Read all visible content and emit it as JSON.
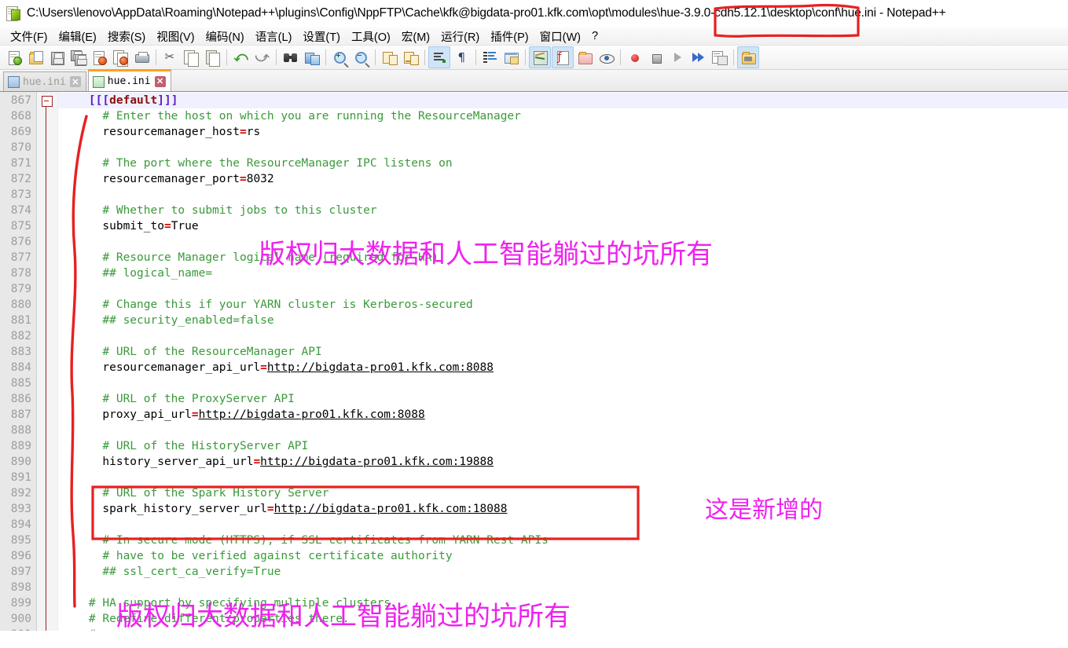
{
  "window": {
    "title": "C:\\Users\\lenovo\\AppData\\Roaming\\Notepad++\\plugins\\Config\\NppFTP\\Cache\\kfk@bigdata-pro01.kfk.com\\opt\\modules\\hue-3.9.0-cdh5.12.1\\desktop\\conf\\hue.ini - Notepad++",
    "icon": "notepad-plus-plus-icon"
  },
  "menubar": {
    "items": [
      {
        "label": "文件(F)",
        "mnemonic": "F"
      },
      {
        "label": "编辑(E)",
        "mnemonic": "E"
      },
      {
        "label": "搜索(S)",
        "mnemonic": "S"
      },
      {
        "label": "视图(V)",
        "mnemonic": "V"
      },
      {
        "label": "编码(N)",
        "mnemonic": "N"
      },
      {
        "label": "语言(L)",
        "mnemonic": "L"
      },
      {
        "label": "设置(T)",
        "mnemonic": "T"
      },
      {
        "label": "工具(O)",
        "mnemonic": "O"
      },
      {
        "label": "宏(M)",
        "mnemonic": "M"
      },
      {
        "label": "运行(R)",
        "mnemonic": "R"
      },
      {
        "label": "插件(P)",
        "mnemonic": "P"
      },
      {
        "label": "窗口(W)",
        "mnemonic": "W"
      },
      {
        "label": "?",
        "mnemonic": ""
      }
    ]
  },
  "toolbar": {
    "buttons": [
      {
        "name": "new-file-icon",
        "group": 0
      },
      {
        "name": "open-file-icon",
        "group": 0
      },
      {
        "name": "save-icon",
        "group": 0
      },
      {
        "name": "save-all-icon",
        "group": 0
      },
      {
        "name": "close-file-icon",
        "group": 0
      },
      {
        "name": "close-all-files-icon",
        "group": 0
      },
      {
        "name": "print-icon",
        "group": 0
      },
      {
        "name": "cut-icon",
        "group": 1
      },
      {
        "name": "copy-icon",
        "group": 1
      },
      {
        "name": "paste-icon",
        "group": 1
      },
      {
        "name": "undo-icon",
        "group": 2
      },
      {
        "name": "redo-icon",
        "group": 2
      },
      {
        "name": "find-icon",
        "group": 3
      },
      {
        "name": "replace-icon",
        "group": 3
      },
      {
        "name": "zoom-in-icon",
        "group": 4
      },
      {
        "name": "zoom-out-icon",
        "group": 4
      },
      {
        "name": "sync-vertical-scroll-icon",
        "group": 5
      },
      {
        "name": "sync-horizontal-scroll-icon",
        "group": 5
      },
      {
        "name": "word-wrap-icon",
        "group": 6,
        "active": true
      },
      {
        "name": "show-all-characters-icon",
        "group": 6
      },
      {
        "name": "indent-guide-icon",
        "group": 7
      },
      {
        "name": "user-defined-dialog-icon",
        "group": 7
      },
      {
        "name": "document-map-icon",
        "group": 8,
        "active": true
      },
      {
        "name": "function-list-icon",
        "group": 8,
        "active": true
      },
      {
        "name": "folder-as-workspace-icon",
        "group": 8
      },
      {
        "name": "monitoring-icon",
        "group": 8
      },
      {
        "name": "record-macro-icon",
        "group": 9
      },
      {
        "name": "stop-recording-icon",
        "group": 9
      },
      {
        "name": "play-macro-icon",
        "group": 9
      },
      {
        "name": "run-macro-multiple-icon",
        "group": 9
      },
      {
        "name": "save-macro-icon",
        "group": 9
      },
      {
        "name": "nppftp-icon",
        "group": 10,
        "active": true
      }
    ]
  },
  "tabs": [
    {
      "label": "hue.ini",
      "active": false,
      "close": "✕"
    },
    {
      "label": "hue.ini",
      "active": true,
      "close": "✕"
    }
  ],
  "editor": {
    "first_line": 867,
    "current_line": 867,
    "lines": [
      {
        "n": 867,
        "segs": [
          {
            "t": "    ",
            "c": "plain"
          },
          {
            "t": "[[[",
            "c": "kw"
          },
          {
            "t": "default",
            "c": "sect"
          },
          {
            "t": "]]]",
            "c": "kw"
          }
        ],
        "current": true,
        "fold": true
      },
      {
        "n": 868,
        "segs": [
          {
            "t": "      # Enter the host on which you are running the ResourceManager",
            "c": "cmt"
          }
        ]
      },
      {
        "n": 869,
        "segs": [
          {
            "t": "      resourcemanager_host",
            "c": "plain"
          },
          {
            "t": "=",
            "c": "eq"
          },
          {
            "t": "rs",
            "c": "plain"
          }
        ]
      },
      {
        "n": 870,
        "segs": []
      },
      {
        "n": 871,
        "segs": [
          {
            "t": "      # The port where the ResourceManager IPC listens on",
            "c": "cmt"
          }
        ]
      },
      {
        "n": 872,
        "segs": [
          {
            "t": "      resourcemanager_port",
            "c": "plain"
          },
          {
            "t": "=",
            "c": "eq"
          },
          {
            "t": "8032",
            "c": "plain"
          }
        ]
      },
      {
        "n": 873,
        "segs": []
      },
      {
        "n": 874,
        "segs": [
          {
            "t": "      # Whether to submit jobs to this cluster",
            "c": "cmt"
          }
        ]
      },
      {
        "n": 875,
        "segs": [
          {
            "t": "      submit_to",
            "c": "plain"
          },
          {
            "t": "=",
            "c": "eq"
          },
          {
            "t": "True",
            "c": "plain"
          }
        ]
      },
      {
        "n": 876,
        "segs": []
      },
      {
        "n": 877,
        "segs": [
          {
            "t": "      # Resource Manager logical name (required for HA)",
            "c": "cmt"
          }
        ]
      },
      {
        "n": 878,
        "segs": [
          {
            "t": "      ## logical_name=",
            "c": "cmt"
          }
        ]
      },
      {
        "n": 879,
        "segs": []
      },
      {
        "n": 880,
        "segs": [
          {
            "t": "      # Change this if your YARN cluster is Kerberos-secured",
            "c": "cmt"
          }
        ]
      },
      {
        "n": 881,
        "segs": [
          {
            "t": "      ## security_enabled=false",
            "c": "cmt"
          }
        ]
      },
      {
        "n": 882,
        "segs": []
      },
      {
        "n": 883,
        "segs": [
          {
            "t": "      # URL of the ResourceManager API",
            "c": "cmt"
          }
        ]
      },
      {
        "n": 884,
        "segs": [
          {
            "t": "      resourcemanager_api_url",
            "c": "plain"
          },
          {
            "t": "=",
            "c": "eq"
          },
          {
            "t": "http://bigdata-pro01.kfk.com:8088",
            "c": "url"
          }
        ]
      },
      {
        "n": 885,
        "segs": []
      },
      {
        "n": 886,
        "segs": [
          {
            "t": "      # URL of the ProxyServer API",
            "c": "cmt"
          }
        ]
      },
      {
        "n": 887,
        "segs": [
          {
            "t": "      proxy_api_url",
            "c": "plain"
          },
          {
            "t": "=",
            "c": "eq"
          },
          {
            "t": "http://bigdata-pro01.kfk.com:8088",
            "c": "url"
          }
        ]
      },
      {
        "n": 888,
        "segs": []
      },
      {
        "n": 889,
        "segs": [
          {
            "t": "      # URL of the HistoryServer API",
            "c": "cmt"
          }
        ]
      },
      {
        "n": 890,
        "segs": [
          {
            "t": "      history_server_api_url",
            "c": "plain"
          },
          {
            "t": "=",
            "c": "eq"
          },
          {
            "t": "http://bigdata-pro01.kfk.com:19888",
            "c": "url"
          }
        ]
      },
      {
        "n": 891,
        "segs": []
      },
      {
        "n": 892,
        "segs": [
          {
            "t": "      # URL of the Spark History Server",
            "c": "cmt"
          }
        ]
      },
      {
        "n": 893,
        "segs": [
          {
            "t": "      spark_history_server_url",
            "c": "plain"
          },
          {
            "t": "=",
            "c": "eq"
          },
          {
            "t": "http://bigdata-pro01.kfk.com:18088",
            "c": "url"
          }
        ]
      },
      {
        "n": 894,
        "segs": []
      },
      {
        "n": 895,
        "segs": [
          {
            "t": "      # In secure mode (HTTPS), if SSL certificates from YARN Rest APIs",
            "c": "cmt"
          }
        ]
      },
      {
        "n": 896,
        "segs": [
          {
            "t": "      # have to be verified against certificate authority",
            "c": "cmt"
          }
        ]
      },
      {
        "n": 897,
        "segs": [
          {
            "t": "      ## ssl_cert_ca_verify=True",
            "c": "cmt"
          }
        ]
      },
      {
        "n": 898,
        "segs": []
      },
      {
        "n": 899,
        "segs": [
          {
            "t": "    # HA support by specifying multiple clusters.",
            "c": "cmt"
          }
        ]
      },
      {
        "n": 900,
        "segs": [
          {
            "t": "    # Redefine different properties there.",
            "c": "cmt"
          }
        ]
      },
      {
        "n": 901,
        "segs": [
          {
            "t": "    # e.g.",
            "c": "cmt"
          }
        ]
      }
    ]
  },
  "annotations": {
    "title_box": {
      "name": "red-rectangle-on-title-path",
      "color": "#e82020"
    },
    "left_curve": {
      "name": "red-curve-left-margin",
      "color": "#e82020"
    },
    "spark_box": {
      "name": "red-rectangle-spark-history",
      "color": "#e82020"
    },
    "note_new": {
      "text": "这是新增的",
      "color": "#ee22ee"
    },
    "watermark_1": {
      "text": "版权归大数据和人工智能躺过的坑所有",
      "color": "#ee22ee"
    },
    "watermark_2": {
      "text": "版权归大数据和人工智能躺过的坑所有",
      "color": "#ee22ee"
    }
  }
}
